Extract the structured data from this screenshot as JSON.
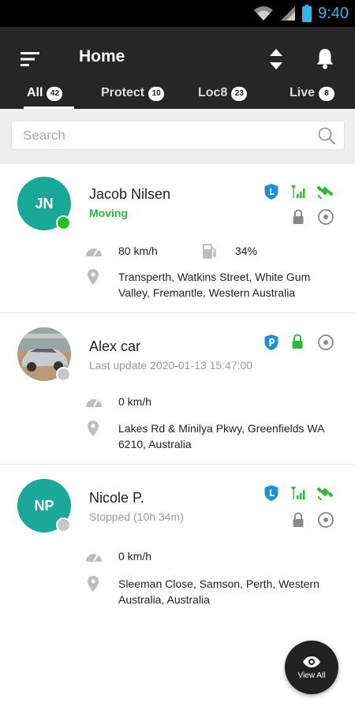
{
  "status_bar": {
    "time": "9:40"
  },
  "header": {
    "title": "Home"
  },
  "tabs": [
    {
      "label": "All",
      "count": "42"
    },
    {
      "label": "Protect",
      "count": "10"
    },
    {
      "label": "Loc8",
      "count": "23"
    },
    {
      "label": "Live",
      "count": "8"
    }
  ],
  "search": {
    "placeholder": "Search"
  },
  "devices": [
    {
      "initials": "JN",
      "name": "Jacob Nilsen",
      "status": "Moving",
      "speed": "80 km/h",
      "battery": "34%",
      "address": "Transperth, Watkins Street, White Gum Valley, Fremantle, Western Australia"
    },
    {
      "initials": "",
      "name": "Alex car",
      "status": "Last update 2020-01-13 15:47:00",
      "speed": "0 km/h",
      "address": "Lakes Rd & Minilya Pkwy, Greenfields WA 6210, Australia"
    },
    {
      "initials": "NP",
      "name": "Nicole P.",
      "status": "Stopped (10h 34m)",
      "speed": "0 km/h",
      "address": "Sleeman Close, Samson, Perth, Western Australia, Australia"
    }
  ],
  "fab": {
    "label": "View All"
  },
  "colors": {
    "accent_teal": "#1aa898",
    "moving_green": "#2cb93a",
    "shield_blue": "#1e90d6",
    "header_dark": "#262626"
  }
}
